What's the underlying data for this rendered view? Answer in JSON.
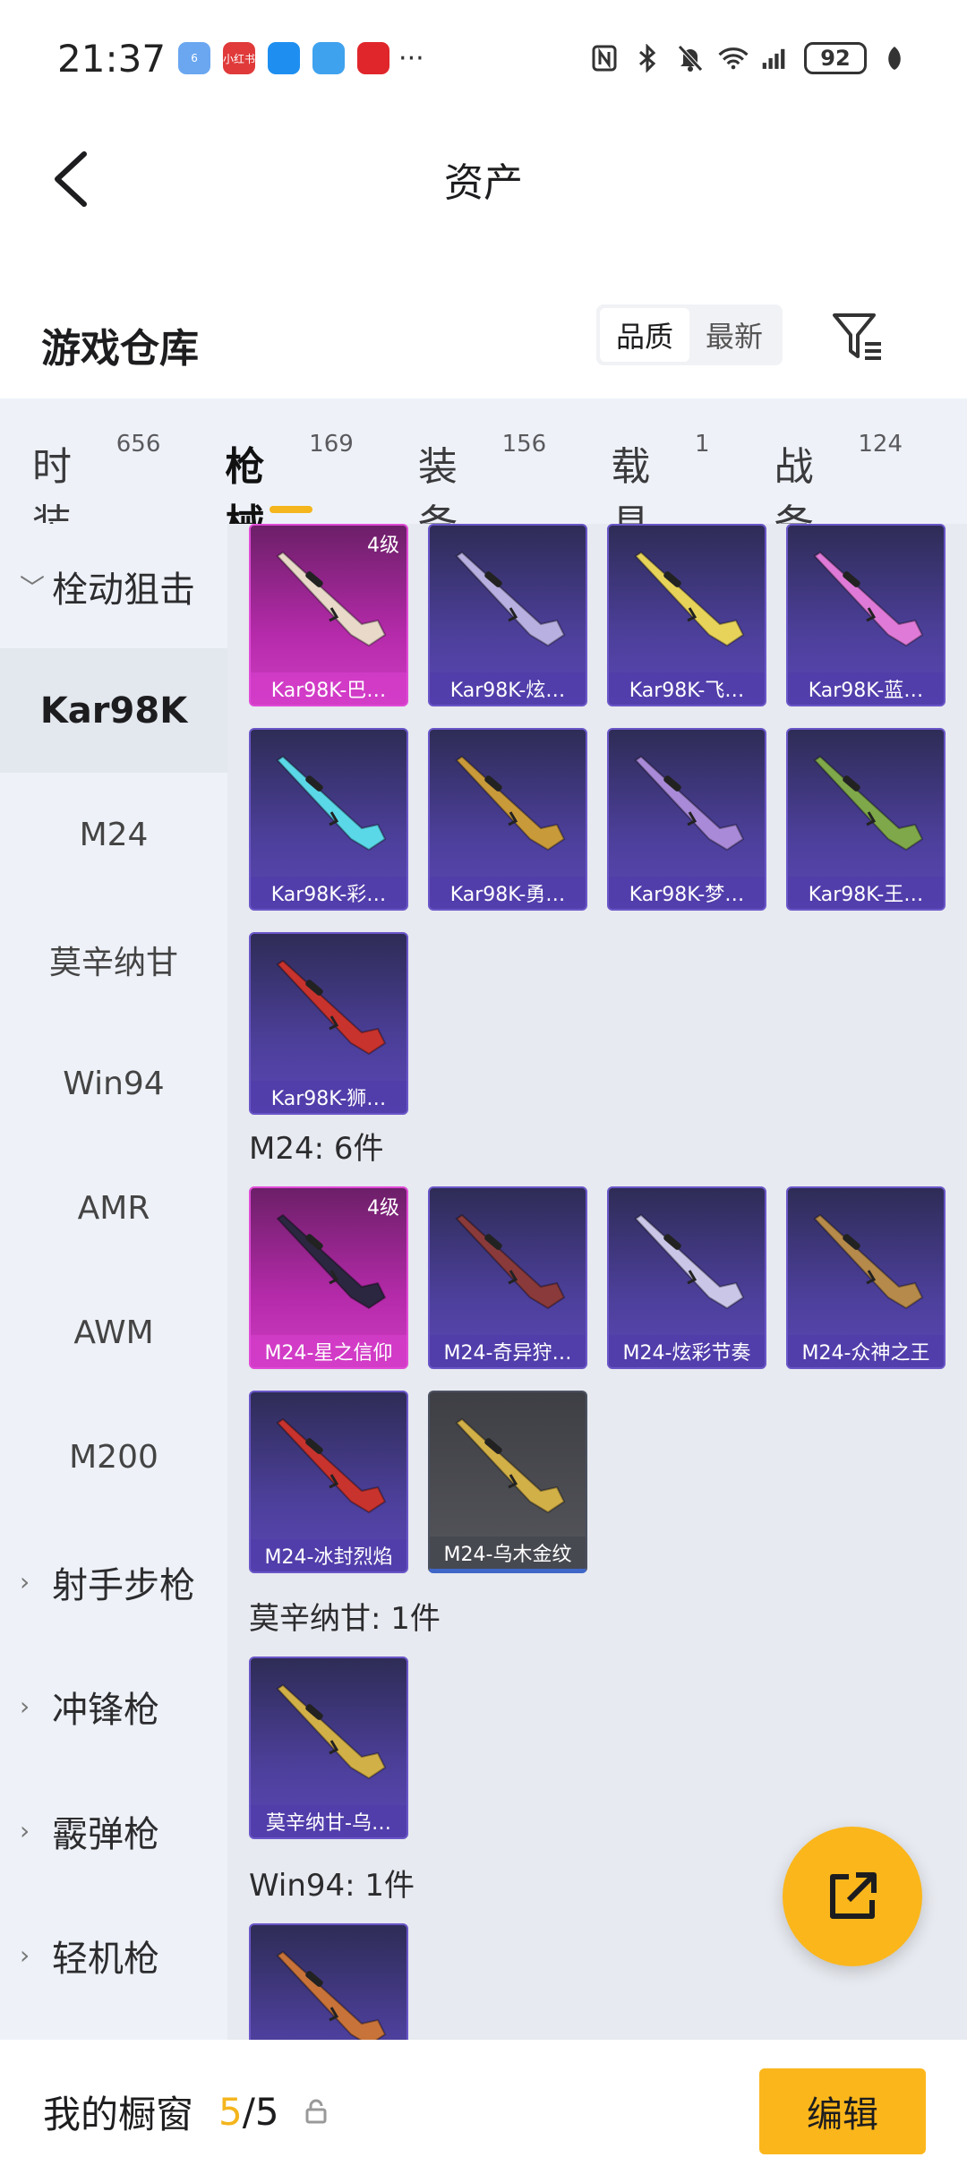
{
  "status": {
    "time": "21:37",
    "app_icons": [
      {
        "name": "app-6-icon",
        "label": "6",
        "color": "#6aa7f0"
      },
      {
        "name": "xiaohongshu-icon",
        "label": "小红书",
        "color": "#e03a3a"
      },
      {
        "name": "chat-icon",
        "label": "",
        "color": "#1e8ff0"
      },
      {
        "name": "browser-icon",
        "label": "",
        "color": "#3fa2ee"
      },
      {
        "name": "heart-app-icon",
        "label": "",
        "color": "#e0262b"
      }
    ],
    "more": "···",
    "battery": "92"
  },
  "nav": {
    "title": "资产"
  },
  "section": {
    "title": "游戏仓库",
    "sort_options": [
      "品质",
      "最新"
    ]
  },
  "tabs": [
    {
      "label": "时装",
      "count": "656",
      "active": false
    },
    {
      "label": "枪械",
      "count": "169",
      "active": true
    },
    {
      "label": "装备",
      "count": "156",
      "active": false
    },
    {
      "label": "载具",
      "count": "1",
      "active": false
    },
    {
      "label": "战备",
      "count": "124",
      "active": false
    }
  ],
  "sidebar": {
    "items": [
      {
        "type": "cat",
        "label": "栓动狙击",
        "chevron": "﹀"
      },
      {
        "type": "sub",
        "label": "Kar98K",
        "active": true
      },
      {
        "type": "sub",
        "label": "M24"
      },
      {
        "type": "sub",
        "label": "莫辛纳甘"
      },
      {
        "type": "sub",
        "label": "Win94"
      },
      {
        "type": "sub",
        "label": "AMR"
      },
      {
        "type": "sub",
        "label": "AWM"
      },
      {
        "type": "sub",
        "label": "M200"
      },
      {
        "type": "cat",
        "label": "射手步枪",
        "chevron": "›"
      },
      {
        "type": "cat",
        "label": "冲锋枪",
        "chevron": "›"
      },
      {
        "type": "cat",
        "label": "霰弹枪",
        "chevron": "›"
      },
      {
        "type": "cat",
        "label": "轻机枪",
        "chevron": "›"
      }
    ]
  },
  "groups": {
    "kar98k": {
      "items": [
        {
          "name": "Kar98K-巴…",
          "level": "4级",
          "style": "pink",
          "gun": "#e8d9c8"
        },
        {
          "name": "Kar98K-炫…",
          "style": "purple",
          "gun": "#b8b0e0"
        },
        {
          "name": "Kar98K-飞…",
          "style": "purple",
          "gun": "#e8d35a"
        },
        {
          "name": "Kar98K-蓝…",
          "style": "purple",
          "gun": "#e07ad8"
        },
        {
          "name": "Kar98K-彩…",
          "style": "purple",
          "gun": "#5ad8e8"
        },
        {
          "name": "Kar98K-勇…",
          "style": "purple",
          "gun": "#c99a3a"
        },
        {
          "name": "Kar98K-梦…",
          "style": "purple",
          "gun": "#a98ad8"
        },
        {
          "name": "Kar98K-王…",
          "style": "purple",
          "gun": "#7fa84a"
        },
        {
          "name": "Kar98K-狮…",
          "style": "purple",
          "gun": "#c8332e"
        }
      ]
    },
    "m24": {
      "title": "M24: 6件",
      "items": [
        {
          "name": "M24-星之信仰",
          "level": "4级",
          "style": "pink",
          "gun": "#2b2740"
        },
        {
          "name": "M24-奇异狩…",
          "style": "purple",
          "gun": "#8a3a3a"
        },
        {
          "name": "M24-炫彩节奏",
          "style": "purple",
          "gun": "#c9c6e8"
        },
        {
          "name": "M24-众神之王",
          "style": "purple",
          "gun": "#b58a4a"
        },
        {
          "name": "M24-冰封烈焰",
          "style": "purple",
          "gun": "#c8332e"
        },
        {
          "name": "M24-乌木金纹",
          "style": "gray",
          "gun": "#d2b048"
        }
      ]
    },
    "mosin": {
      "title": "莫辛纳甘: 1件",
      "items": [
        {
          "name": "莫辛纳甘-乌…",
          "style": "purple",
          "gun": "#d2b048"
        }
      ]
    },
    "win94": {
      "title": "Win94: 1件",
      "items": [
        {
          "name": "",
          "style": "purple",
          "gun": "#c8733a"
        }
      ]
    }
  },
  "bottom": {
    "label": "我的橱窗",
    "current": "5",
    "separator": "/",
    "total": "5",
    "edit": "编辑"
  },
  "colors": {
    "accent": "#f4b51d",
    "rare_purple": "#5b47b4",
    "rare_pink": "#cf3dc3"
  }
}
